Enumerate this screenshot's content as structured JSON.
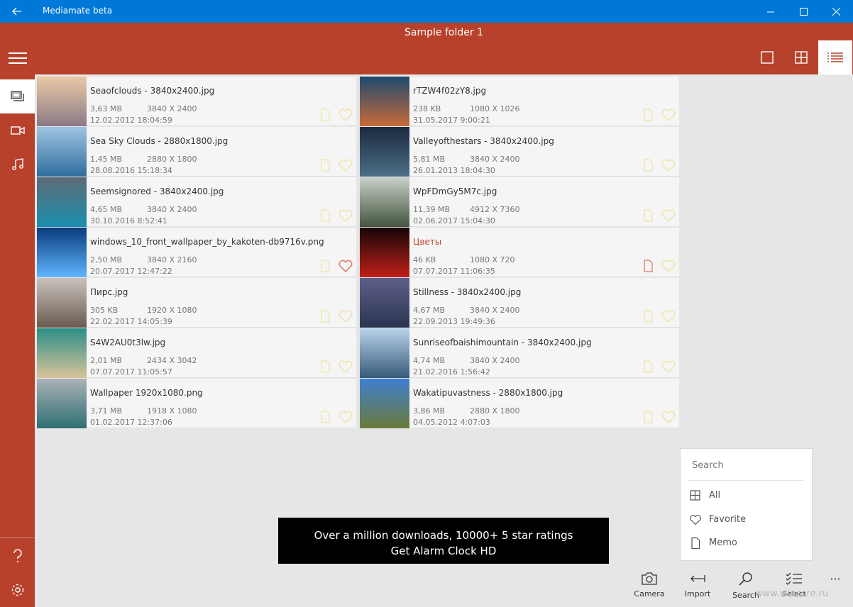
{
  "window": {
    "title": "Mediamate beta",
    "back_icon": "back-arrow-icon",
    "controls": [
      "minimize-icon",
      "maximize-icon",
      "close-icon"
    ]
  },
  "header": {
    "folder_title": "Sample folder 1",
    "view_modes": [
      "single",
      "grid",
      "list"
    ],
    "active_view": "list"
  },
  "sidebar": {
    "items": [
      "menu",
      "photos",
      "videos",
      "music"
    ],
    "active": "photos",
    "bottom": [
      "help",
      "settings"
    ]
  },
  "items": [
    {
      "name": "Seaofclouds - 3840x2400.jpg",
      "size": "3,63 MB",
      "dims": "3840 X 2400",
      "date": "12.02.2012 18:04:59",
      "favorite": false,
      "memo": false,
      "colors": [
        "#e9c9a6",
        "#8a7a85"
      ]
    },
    {
      "name": "rTZW4f02zY8.jpg",
      "size": "238 KB",
      "dims": "1080 X 1026",
      "date": "31.05.2017 9:00:21",
      "favorite": false,
      "memo": false,
      "colors": [
        "#1d4a6e",
        "#c96a3a"
      ]
    },
    {
      "name": "Sea Sky Clouds - 2880x1800.jpg",
      "size": "1,45 MB",
      "dims": "2880 X 1800",
      "date": "28.08.2016 15:18:34",
      "favorite": false,
      "memo": false,
      "colors": [
        "#9fc4e2",
        "#2f6d9c"
      ]
    },
    {
      "name": "Valleyofthestars - 3840x2400.jpg",
      "size": "5,81 MB",
      "dims": "3840 X 2400",
      "date": "26.01.2013 18:04:30",
      "favorite": false,
      "memo": false,
      "colors": [
        "#1a2a3e",
        "#4c6f88"
      ]
    },
    {
      "name": "Seemsignored - 3840x2400.jpg",
      "size": "4,65 MB",
      "dims": "3840 X 2400",
      "date": "30.10.2016 8:52:41",
      "favorite": false,
      "memo": false,
      "colors": [
        "#5d6b75",
        "#1b8fb0"
      ]
    },
    {
      "name": "WpFDmGy5M7c.jpg",
      "size": "11,39 MB",
      "dims": "4912 X 7360",
      "date": "02.06.2017 15:04:30",
      "favorite": false,
      "memo": false,
      "colors": [
        "#c7d0c8",
        "#44553f"
      ]
    },
    {
      "name": "windows_10_front_wallpaper_by_kakoten-db9716v.png",
      "size": "2,50 MB",
      "dims": "3840 X 2160",
      "date": "20.07.2017 12:47:22",
      "favorite": true,
      "memo": false,
      "colors": [
        "#0a3b7c",
        "#5fb6ff"
      ]
    },
    {
      "name": "Цветы",
      "size": "46 KB",
      "dims": "1080 X 720",
      "date": "07.07.2017 11:06:35",
      "favorite": false,
      "memo": true,
      "colors": [
        "#160606",
        "#c0201a"
      ],
      "highlight": true
    },
    {
      "name": "Пирс.jpg",
      "size": "305 KB",
      "dims": "1920 X 1080",
      "date": "22.02.2017 14:05:39",
      "favorite": false,
      "memo": false,
      "colors": [
        "#c9c3bd",
        "#6a5a50"
      ]
    },
    {
      "name": "Stillness - 3840x2400.jpg",
      "size": "4,67 MB",
      "dims": "3840 X 2400",
      "date": "22.09.2013 19:49:36",
      "favorite": false,
      "memo": false,
      "colors": [
        "#5f5f8a",
        "#2a3550"
      ]
    },
    {
      "name": "S4W2AU0t3lw.jpg",
      "size": "2,01 MB",
      "dims": "2434 X 3042",
      "date": "07.07.2017 11:05:57",
      "favorite": false,
      "memo": false,
      "colors": [
        "#2c8f86",
        "#d8c39a"
      ]
    },
    {
      "name": "Sunriseofbaishimountain - 3840x2400.jpg",
      "size": "4,74 MB",
      "dims": "3840 X 2400",
      "date": "21.02.2016 1:56:42",
      "favorite": false,
      "memo": false,
      "colors": [
        "#b9d3ea",
        "#375a7a"
      ]
    },
    {
      "name": "Wallpaper 1920x1080.png",
      "size": "3,71 MB",
      "dims": "1918 X 1080",
      "date": "01.02.2017 12:37:06",
      "favorite": false,
      "memo": false,
      "colors": [
        "#aab2b6",
        "#2d6f73"
      ]
    },
    {
      "name": "Wakatipuvastness - 2880x1800.jpg",
      "size": "3,86 MB",
      "dims": "2880 X 1800",
      "date": "04.05.2012 4:07:03",
      "favorite": false,
      "memo": false,
      "colors": [
        "#3f7fd0",
        "#6a7a3a"
      ]
    }
  ],
  "search_panel": {
    "placeholder": "Search",
    "filters": [
      {
        "label": "All",
        "icon": "grid-icon"
      },
      {
        "label": "Favorite",
        "icon": "heart-icon"
      },
      {
        "label": "Memo",
        "icon": "document-icon"
      }
    ]
  },
  "ad": {
    "line1": "Over a million downloads, 10000+ 5 star ratings",
    "line2": "Get Alarm Clock HD"
  },
  "commands": [
    {
      "label": "Camera",
      "icon": "camera-icon"
    },
    {
      "label": "Import",
      "icon": "import-icon"
    },
    {
      "label": "Search",
      "icon": "search-icon"
    },
    {
      "label": "Select",
      "icon": "select-icon"
    }
  ],
  "watermark": "www.wincore.ru",
  "colors": {
    "accent": "#b7412a",
    "titlebar": "#0078d7",
    "favorite": "#e0735e",
    "inactive_icon": "#efe3a8"
  }
}
